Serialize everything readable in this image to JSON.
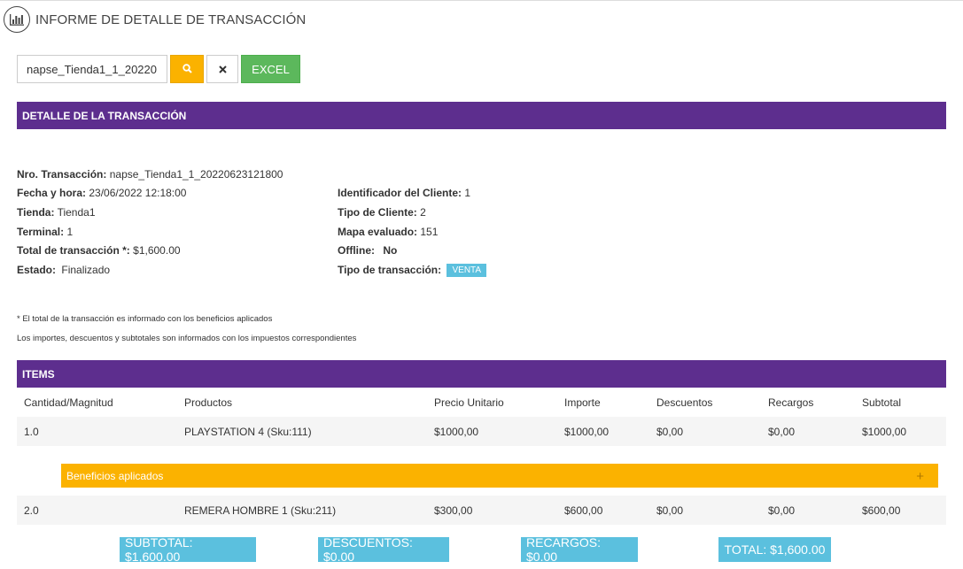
{
  "header": {
    "title": "INFORME DE DETALLE DE TRANSACCIÓN",
    "icon": "bar-chart-icon"
  },
  "toolbar": {
    "search_value": "napse_Tienda1_1_20220",
    "search_icon": "search-icon",
    "clear_icon": "close-icon",
    "excel_label": "EXCEL"
  },
  "colors": {
    "section_bar": "#5d2e8e",
    "accent_orange": "#fbb200",
    "excel_green": "#5cb85c",
    "badge_blue": "#5bc0de"
  },
  "detail": {
    "section_title": "DETALLE DE LA TRANSACCIÓN",
    "nro_label": "Nro. Transacción:",
    "nro_value": "napse_Tienda1_1_20220623121800",
    "fecha_label": "Fecha y hora:",
    "fecha_value": "23/06/2022 12:18:00",
    "tienda_label": "Tienda:",
    "tienda_value": "Tienda1",
    "terminal_label": "Terminal:",
    "terminal_value": "1",
    "total_label": "Total de transacción *:",
    "total_value": "$1,600.00",
    "estado_label": "Estado:",
    "estado_value": "Finalizado",
    "cliente_label": "Identificador del Cliente:",
    "cliente_value": "1",
    "tipo_cliente_label": "Tipo de Cliente:",
    "tipo_cliente_value": "2",
    "mapa_label": "Mapa evaluado:",
    "mapa_value": "151",
    "offline_label": "Offline:",
    "offline_value": "No",
    "tipo_trans_label": "Tipo de transacción:",
    "tipo_trans_value": "VENTA"
  },
  "notes": {
    "note1": "* El total de la transacción es informado con los beneficios aplicados",
    "note2": "Los importes, descuentos y subtotales son informados con los impuestos correspondientes"
  },
  "items": {
    "section_title": "ITEMS",
    "columns": [
      "Cantidad/Magnitud",
      "Productos",
      "Precio Unitario",
      "Importe",
      "Descuentos",
      "Recargos",
      "Subtotal"
    ],
    "rows": [
      [
        "1.0",
        "PLAYSTATION 4 (Sku:111)",
        "$1000,00",
        "$1000,00",
        "$0,00",
        "$0,00",
        "$1000,00"
      ],
      [
        "2.0",
        "REMERA HOMBRE 1 (Sku:211)",
        "$300,00",
        "$600,00",
        "$0,00",
        "$0,00",
        "$600,00"
      ]
    ],
    "benefits_label": "Beneficios aplicados",
    "benefits_expand": "+"
  },
  "totals": {
    "subtotal": "SUBTOTAL: $1,600.00",
    "descuentos": "DESCUENTOS: $0.00",
    "recargos": "RECARGOS: $0.00",
    "total": "TOTAL: $1,600.00"
  }
}
